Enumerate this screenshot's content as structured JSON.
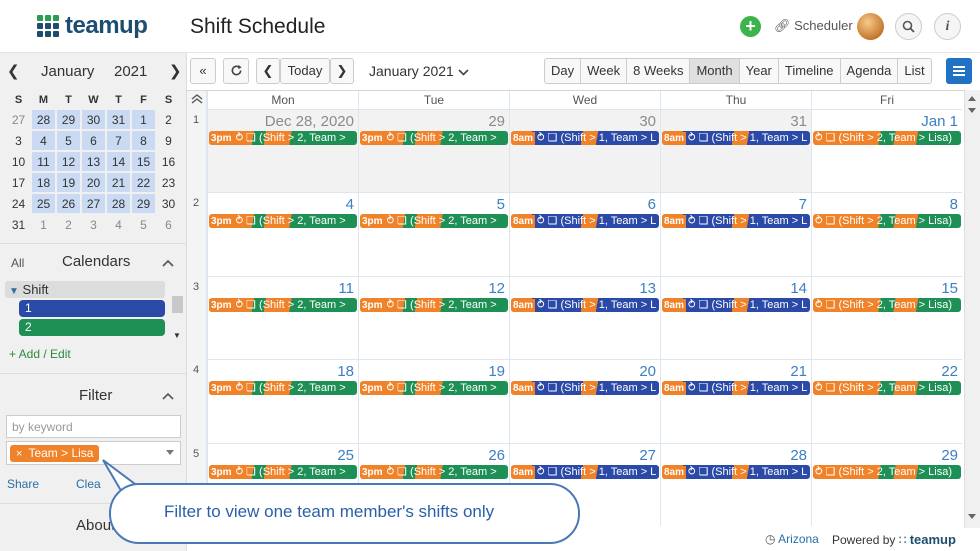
{
  "header": {
    "logo_text": "teamup",
    "title": "Shift Schedule",
    "add_icon": "plus-icon",
    "user_label": "Scheduler",
    "search_icon": "search-icon",
    "info_icon": "info-icon"
  },
  "mini_calendar": {
    "month": "January",
    "year": "2021",
    "weekdays": [
      "S",
      "M",
      "T",
      "W",
      "T",
      "F",
      "S"
    ],
    "weeks": [
      [
        "27",
        "28",
        "29",
        "30",
        "31",
        "1",
        "2"
      ],
      [
        "3",
        "4",
        "5",
        "6",
        "7",
        "8",
        "9"
      ],
      [
        "10",
        "11",
        "12",
        "13",
        "14",
        "15",
        "16"
      ],
      [
        "17",
        "18",
        "19",
        "20",
        "21",
        "22",
        "23"
      ],
      [
        "24",
        "25",
        "26",
        "27",
        "28",
        "29",
        "30"
      ],
      [
        "31",
        "1",
        "2",
        "3",
        "4",
        "5",
        "6"
      ]
    ]
  },
  "calendars": {
    "all_label": "All",
    "title": "Calendars",
    "group": "Shift",
    "items": [
      {
        "label": "1",
        "color": "#2b4aa7"
      },
      {
        "label": "2",
        "color": "#1e8f55"
      }
    ],
    "add_edit": "+ Add / Edit"
  },
  "filter": {
    "title": "Filter",
    "keyword_placeholder": "by keyword",
    "tag_remove": "×",
    "tag": "Team > Lisa",
    "share": "Share",
    "clear": "Clea"
  },
  "sidebar_about": "About",
  "toolbar": {
    "today": "Today",
    "date_label": "January 2021",
    "views": [
      "Day",
      "Week",
      "8 Weeks",
      "Month",
      "Year",
      "Timeline",
      "Agenda",
      "List"
    ],
    "active_view": "Month"
  },
  "calendar": {
    "day_headers": [
      "Mon",
      "Tue",
      "Wed",
      "Thu",
      "Fri"
    ],
    "weeks": [
      {
        "week": "1",
        "days": [
          "Dec 28, 2020",
          "29",
          "30",
          "31",
          "Jan 1"
        ]
      },
      {
        "week": "2",
        "days": [
          "4",
          "5",
          "6",
          "7",
          "8"
        ]
      },
      {
        "week": "3",
        "days": [
          "11",
          "12",
          "13",
          "14",
          "15"
        ]
      },
      {
        "week": "4",
        "days": [
          "18",
          "19",
          "20",
          "21",
          "22"
        ]
      },
      {
        "week": "5",
        "days": [
          "25",
          "26",
          "27",
          "28",
          "29"
        ]
      }
    ],
    "events": {
      "mon": {
        "time": "3pm",
        "text": "⥁ ❏ (Shift > 2, Team >"
      },
      "tue": {
        "time": "3pm",
        "text": "⥁ ❏ (Shift > 2, Team >"
      },
      "wed": {
        "time": "8am",
        "text": "⥁ ❏ (Shift > 1, Team > L"
      },
      "thu": {
        "time": "8am",
        "text": "⥁ ❏ (Shift > 1, Team > L"
      },
      "fri": {
        "time": "",
        "text": "⥁ ❏ (Shift > 2, Team > Lisa)"
      }
    }
  },
  "footer": {
    "timezone": "Arizona",
    "powered_by": "Powered by",
    "brand": "teamup"
  },
  "callout": "Filter to view one team member's shifts only",
  "colors": {
    "orange": "#f0832a",
    "green": "#1e8f55",
    "blue": "#2b4aa7",
    "accent": "#1f72c4"
  }
}
